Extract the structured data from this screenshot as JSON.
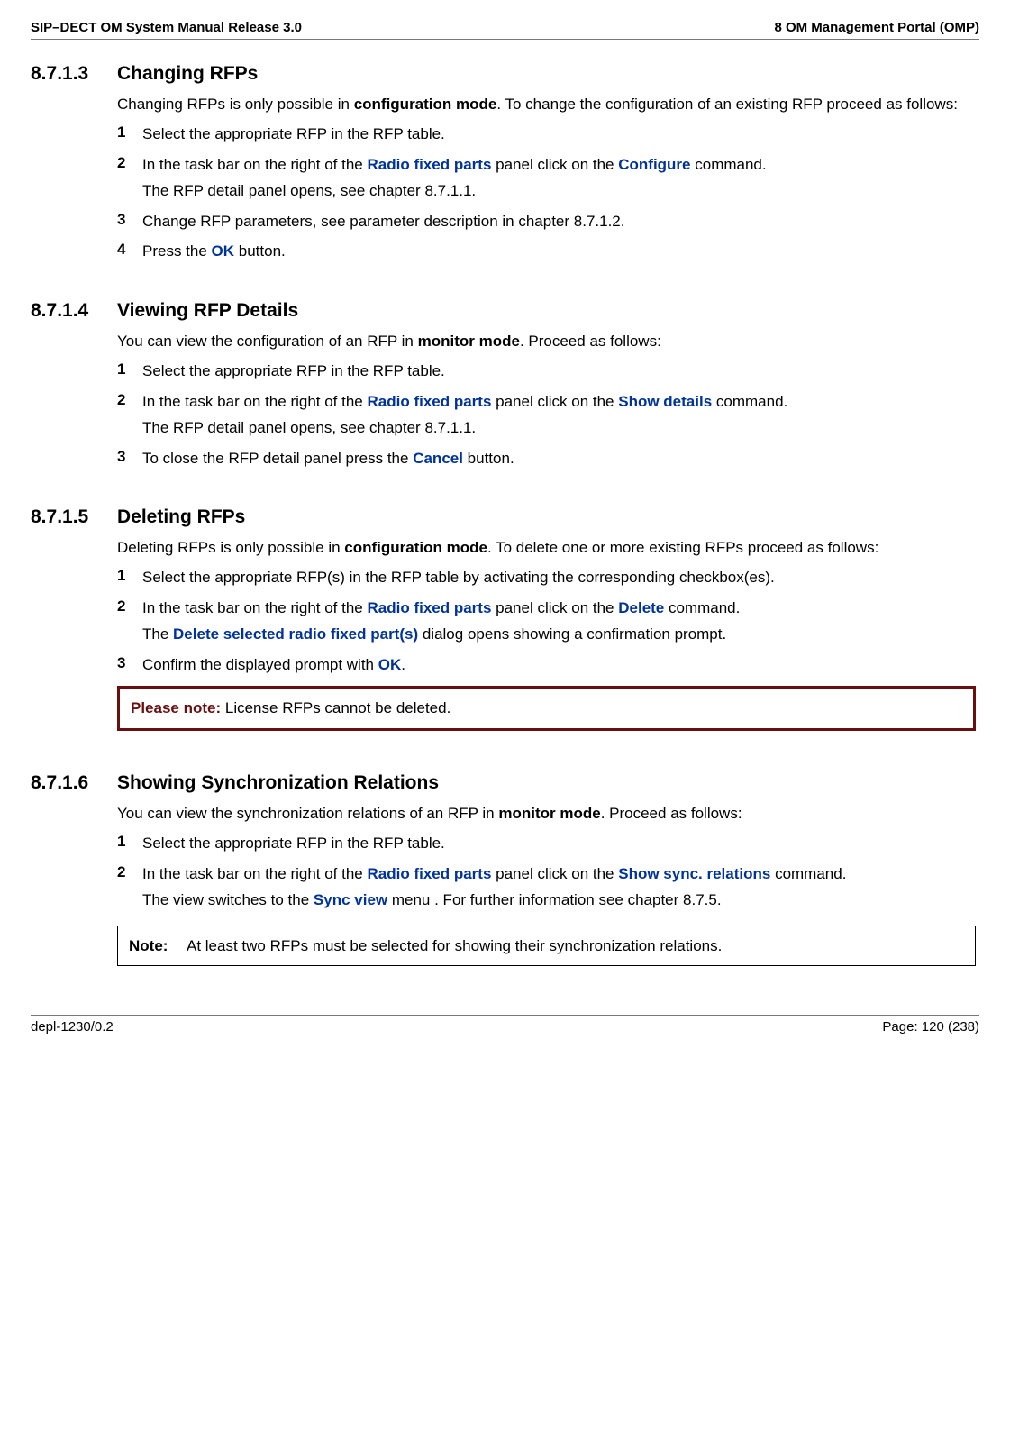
{
  "header": {
    "left": "SIP–DECT OM System Manual Release 3.0",
    "right": "8 OM Management Portal (OMP)"
  },
  "sections": {
    "s1": {
      "num": "8.7.1.3",
      "title": "Changing RFPs",
      "intro_a": "Changing RFPs is only possible in ",
      "intro_b": "configuration mode",
      "intro_c": ". To change the configuration of an existing RFP proceed as follows:",
      "step1_num": "1",
      "step1": "Select the appropriate RFP in the RFP table.",
      "step2_num": "2",
      "step2_a": "In the task bar on the right of the ",
      "step2_b": "Radio fixed parts",
      "step2_c": " panel click on the ",
      "step2_d": "Configure",
      "step2_e": " command.",
      "step2_sub": "The RFP detail panel opens, see chapter 8.7.1.1.",
      "step3_num": "3",
      "step3": "Change RFP parameters, see parameter description in chapter 8.7.1.2.",
      "step4_num": "4",
      "step4_a": "Press the ",
      "step4_b": "OK",
      "step4_c": " button."
    },
    "s2": {
      "num": "8.7.1.4",
      "title": "Viewing RFP Details",
      "intro_a": "You can view the configuration of an RFP in ",
      "intro_b": "monitor mode",
      "intro_c": ". Proceed as follows:",
      "step1_num": "1",
      "step1": "Select the appropriate RFP in the RFP table.",
      "step2_num": "2",
      "step2_a": "In the task bar on the right of the ",
      "step2_b": "Radio fixed parts",
      "step2_c": " panel click on the ",
      "step2_d": "Show details",
      "step2_e": " command.",
      "step2_sub": "The RFP detail panel opens, see chapter 8.7.1.1.",
      "step3_num": "3",
      "step3_a": "To close the RFP detail panel press the ",
      "step3_b": "Cancel",
      "step3_c": " button."
    },
    "s3": {
      "num": "8.7.1.5",
      "title": "Deleting RFPs",
      "intro_a": "Deleting RFPs is only possible in ",
      "intro_b": "configuration mode",
      "intro_c": ". To delete one or more existing RFPs proceed as follows:",
      "step1_num": "1",
      "step1": "Select the appropriate RFP(s) in the RFP table by activating the corresponding checkbox(es).",
      "step2_num": "2",
      "step2_a": "In the task bar on the right of the ",
      "step2_b": "Radio fixed parts",
      "step2_c": " panel click on the ",
      "step2_d": "Delete",
      "step2_e": " command.",
      "step2_sub_a": "The ",
      "step2_sub_b": "Delete selected radio fixed part(s)",
      "step2_sub_c": " dialog opens showing a confirmation prompt.",
      "step3_num": "3",
      "step3_a": "Confirm the displayed prompt with ",
      "step3_b": "OK",
      "step3_c": ".",
      "note_label": "Please note:  ",
      "note_text": "License RFPs cannot be deleted."
    },
    "s4": {
      "num": "8.7.1.6",
      "title": "Showing Synchronization Relations",
      "intro_a": "You can view the synchronization relations of an RFP in ",
      "intro_b": "monitor mode",
      "intro_c": ". Proceed as follows:",
      "step1_num": "1",
      "step1": "Select the appropriate RFP in the RFP table.",
      "step2_num": "2",
      "step2_a": "In the task bar on the right of the ",
      "step2_b": "Radio fixed parts",
      "step2_c": " panel click on the ",
      "step2_d": "Show sync. relations",
      "step2_e": " command.",
      "step2_sub_a": "The view switches to the ",
      "step2_sub_b": "Sync view",
      "step2_sub_c": " menu . For further information see chapter 8.7.5.",
      "note_label": "Note:",
      "note_text": "At least two RFPs must be selected for showing their synchronization relations."
    }
  },
  "footer": {
    "left": "depl-1230/0.2",
    "right": "Page: 120 (238)"
  }
}
